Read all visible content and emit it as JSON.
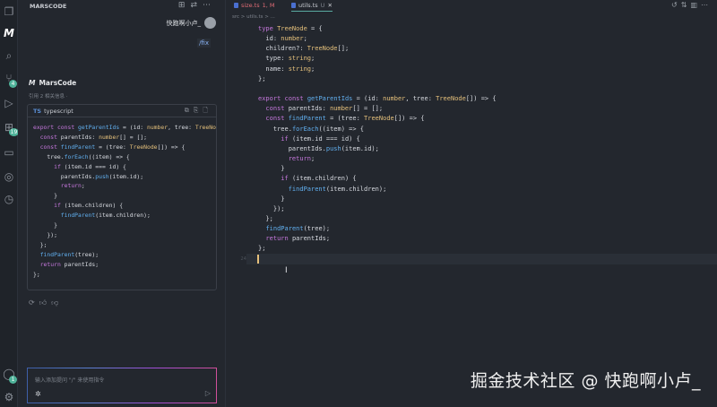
{
  "sidebar": {
    "title": "MARSCODE",
    "user": "快跑啊小卢_",
    "command": "/fix",
    "assistant": "MarsCode",
    "reference": "引用 2 相关信息 ·",
    "code_lang_badge": "TS",
    "code_lang": "typescript",
    "code": [
      [
        [
          "export ",
          "k"
        ],
        [
          "const ",
          "k"
        ],
        [
          "getParentIds",
          "f"
        ],
        [
          " = (id: ",
          "p"
        ],
        [
          "number",
          "t"
        ],
        [
          ", tree: ",
          "p"
        ],
        [
          "TreeNode",
          "t"
        ]
      ],
      [
        [
          "  const ",
          "k"
        ],
        [
          "parentIds: ",
          "p"
        ],
        [
          "number",
          "t"
        ],
        [
          "[] = [];",
          "p"
        ]
      ],
      [
        [
          "  const ",
          "k"
        ],
        [
          "findParent",
          "f"
        ],
        [
          " = (tree: ",
          "p"
        ],
        [
          "TreeNode",
          "t"
        ],
        [
          "[]) => {",
          "p"
        ]
      ],
      [
        [
          "    tree.",
          "p"
        ],
        [
          "forEach",
          "f"
        ],
        [
          "((item) => {",
          "p"
        ]
      ],
      [
        [
          "      ",
          "p"
        ],
        [
          "if ",
          "k"
        ],
        [
          "(item.id === id) {",
          "p"
        ]
      ],
      [
        [
          "        parentIds.",
          "p"
        ],
        [
          "push",
          "f"
        ],
        [
          "(item.id);",
          "p"
        ]
      ],
      [
        [
          "        ",
          "p"
        ],
        [
          "return",
          "k"
        ],
        [
          ";",
          "p"
        ]
      ],
      [
        [
          "      }",
          "p"
        ]
      ],
      [
        [
          "      ",
          "p"
        ],
        [
          "if ",
          "k"
        ],
        [
          "(item.children) {",
          "p"
        ]
      ],
      [
        [
          "        ",
          "p"
        ],
        [
          "findParent",
          "f"
        ],
        [
          "(item.children);",
          "p"
        ]
      ],
      [
        [
          "      }",
          "p"
        ]
      ],
      [
        [
          "    });",
          "p"
        ]
      ],
      [
        [
          "  };",
          "p"
        ]
      ],
      [
        [
          "  ",
          "p"
        ],
        [
          "findParent",
          "f"
        ],
        [
          "(tree);",
          "p"
        ]
      ],
      [
        [
          "  ",
          "p"
        ],
        [
          "return ",
          "k"
        ],
        [
          "parentIds;",
          "p"
        ]
      ],
      [
        [
          "};",
          "p"
        ]
      ]
    ],
    "input_placeholder": "输入添加提问 \"/\" 来使用指令",
    "badges": {
      "scm": "4",
      "ext": "19",
      "account": "1"
    }
  },
  "editor": {
    "tabs": [
      {
        "label": "size.ts",
        "status": "1, M"
      },
      {
        "label": "utils.ts",
        "status": "U"
      }
    ],
    "breadcrumb": "src > utils.ts > ...",
    "current_line": "24",
    "code": [
      [
        [
          "type ",
          "k"
        ],
        [
          "TreeNode",
          "t"
        ],
        [
          " = {",
          "p"
        ]
      ],
      [
        [
          "  id: ",
          "p"
        ],
        [
          "number",
          "t"
        ],
        [
          ";",
          "p"
        ]
      ],
      [
        [
          "  children?: ",
          "p"
        ],
        [
          "TreeNode",
          "t"
        ],
        [
          "[];",
          "p"
        ]
      ],
      [
        [
          "  type: ",
          "p"
        ],
        [
          "string",
          "t"
        ],
        [
          ";",
          "p"
        ]
      ],
      [
        [
          "  name: ",
          "p"
        ],
        [
          "string",
          "t"
        ],
        [
          ";",
          "p"
        ]
      ],
      [
        [
          "};",
          "p"
        ]
      ],
      [
        [
          "",
          "p"
        ]
      ],
      [
        [
          "export ",
          "k"
        ],
        [
          "const ",
          "k"
        ],
        [
          "getParentIds",
          "f"
        ],
        [
          " = (id: ",
          "p"
        ],
        [
          "number",
          "t"
        ],
        [
          ", tree: ",
          "p"
        ],
        [
          "TreeNode",
          "t"
        ],
        [
          "[]) => {",
          "p"
        ]
      ],
      [
        [
          "  const ",
          "k"
        ],
        [
          "parentIds: ",
          "p"
        ],
        [
          "number",
          "t"
        ],
        [
          "[] = [];",
          "p"
        ]
      ],
      [
        [
          "  const ",
          "k"
        ],
        [
          "findParent",
          "f"
        ],
        [
          " = (tree: ",
          "p"
        ],
        [
          "TreeNode",
          "t"
        ],
        [
          "[]) => {",
          "p"
        ]
      ],
      [
        [
          "    tree.",
          "p"
        ],
        [
          "forEach",
          "f"
        ],
        [
          "((item) => {",
          "p"
        ]
      ],
      [
        [
          "      ",
          "p"
        ],
        [
          "if ",
          "k"
        ],
        [
          "(item.id === id) {",
          "p"
        ]
      ],
      [
        [
          "        parentIds.",
          "p"
        ],
        [
          "push",
          "f"
        ],
        [
          "(item.id);",
          "p"
        ]
      ],
      [
        [
          "        ",
          "p"
        ],
        [
          "return",
          "k"
        ],
        [
          ";",
          "p"
        ]
      ],
      [
        [
          "      }",
          "p"
        ]
      ],
      [
        [
          "      ",
          "p"
        ],
        [
          "if ",
          "k"
        ],
        [
          "(item.children) {",
          "p"
        ]
      ],
      [
        [
          "        ",
          "p"
        ],
        [
          "findParent",
          "f"
        ],
        [
          "(item.children);",
          "p"
        ]
      ],
      [
        [
          "      }",
          "p"
        ]
      ],
      [
        [
          "    });",
          "p"
        ]
      ],
      [
        [
          "  };",
          "p"
        ]
      ],
      [
        [
          "  ",
          "p"
        ],
        [
          "findParent",
          "f"
        ],
        [
          "(tree);",
          "p"
        ]
      ],
      [
        [
          "  ",
          "p"
        ],
        [
          "return ",
          "k"
        ],
        [
          "parentIds;",
          "p"
        ]
      ],
      [
        [
          "};",
          "p"
        ]
      ]
    ]
  },
  "watermark": "掘金技术社区 @ 快跑啊小卢_"
}
